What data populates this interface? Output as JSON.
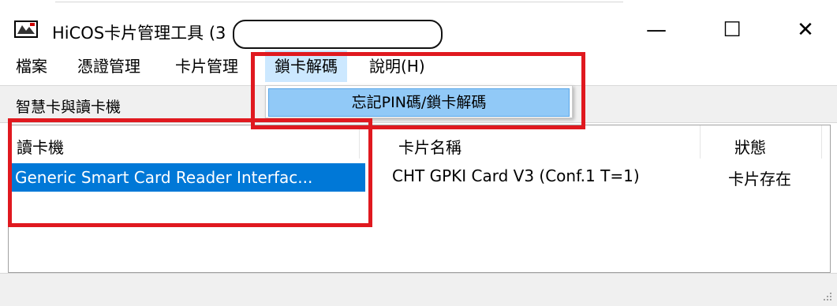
{
  "window": {
    "title": "HiCOS卡片管理工具 (3",
    "icon": "hicos-card-icon",
    "controls": {
      "minimize": "—",
      "maximize": "☐",
      "close": "✕"
    }
  },
  "menu": {
    "items": [
      "檔案",
      "憑證管理",
      "卡片管理",
      "鎖卡解碼",
      "說明(H)"
    ],
    "active_index": 3,
    "dropdown": {
      "items": [
        "忘記PIN碼/鎖卡解碼"
      ]
    }
  },
  "toolbar": {
    "label": "智慧卡與讀卡機"
  },
  "table": {
    "columns": [
      "讀卡機",
      "卡片名稱",
      "狀態"
    ],
    "rows": [
      [
        "Generic Smart Card Reader Interfac...",
        "CHT GPKI Card V3 (Conf.1 T=1)",
        "卡片存在"
      ]
    ],
    "selected_row": 0
  },
  "colors": {
    "selection": "#0078d7",
    "menu_highlight": "#cce8ff",
    "annotation": "#e0191f"
  }
}
